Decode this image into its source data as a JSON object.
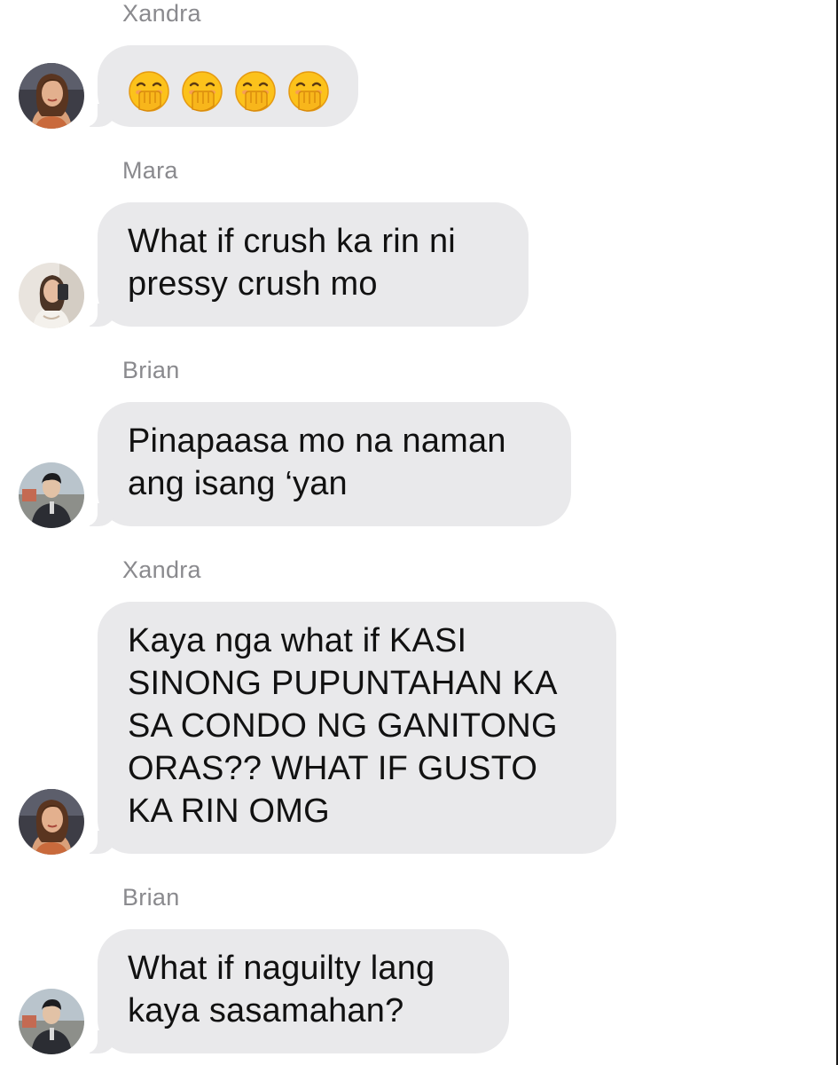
{
  "messages": [
    {
      "sender": "Xandra",
      "avatar": "xandra-avatar",
      "emoji_count": 4,
      "emoji": "face-with-hand-over-mouth-icon",
      "lines": []
    },
    {
      "sender": "Mara",
      "avatar": "mara-avatar",
      "lines": [
        "What if crush ka rin ni",
        "pressy crush mo"
      ]
    },
    {
      "sender": "Brian",
      "avatar": "brian-avatar",
      "lines": [
        "Pinapaasa mo na naman",
        "ang isang ‘yan"
      ]
    },
    {
      "sender": "Xandra",
      "avatar": "xandra-avatar",
      "lines": [
        "Kaya nga what if KASI",
        "SINONG PUPUNTAHAN KA",
        "SA CONDO NG GANITONG",
        "ORAS?? WHAT IF GUSTO",
        "KA RIN OMG"
      ]
    },
    {
      "sender": "Brian",
      "avatar": "brian-avatar",
      "lines": [
        "What if naguilty lang",
        "kaya sasamahan?"
      ]
    }
  ],
  "colors": {
    "bubble": "#e9e9eb",
    "sender_name": "#8a8a8e",
    "text": "#111111",
    "background": "#ffffff"
  }
}
